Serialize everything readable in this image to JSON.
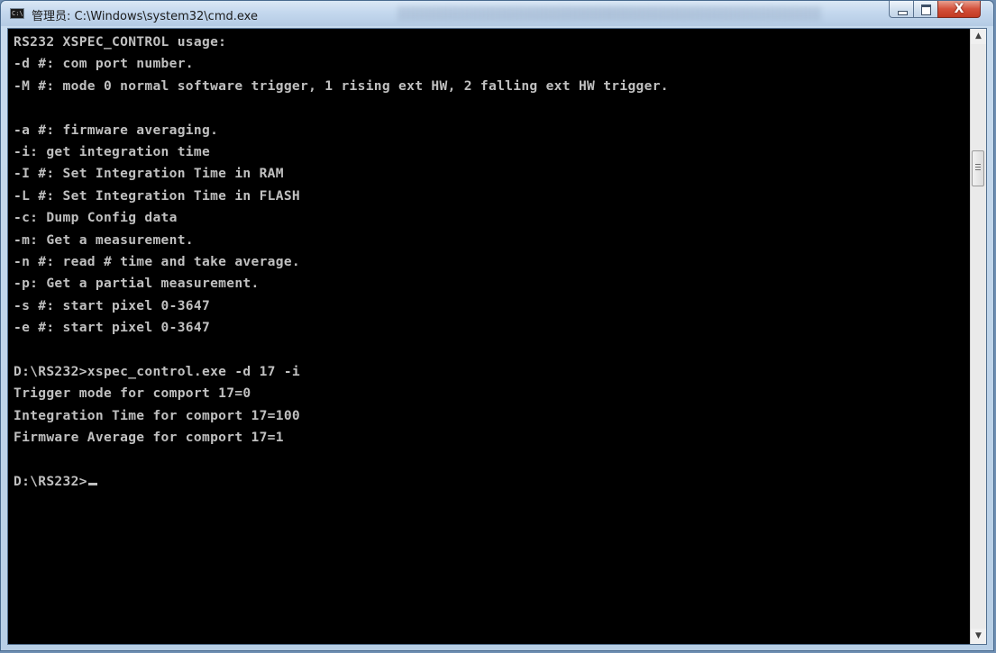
{
  "window": {
    "title": "管理员: C:\\Windows\\system32\\cmd.exe",
    "icon": "console-icon",
    "icon_label": "C:\\",
    "buttons": {
      "minimize": "minimize-icon",
      "maximize": "maximize-icon",
      "close": "X"
    }
  },
  "console": {
    "lines": [
      "RS232 XSPEC_CONTROL usage:",
      "-d #: com port number.",
      "-M #: mode 0 normal software trigger, 1 rising ext HW, 2 falling ext HW trigger.",
      "",
      "-a #: firmware averaging.",
      "-i: get integration time",
      "-I #: Set Integration Time in RAM",
      "-L #: Set Integration Time in FLASH",
      "-c: Dump Config data",
      "-m: Get a measurement.",
      "-n #: read # time and take average.",
      "-p: Get a partial measurement.",
      "-s #: start pixel 0-3647",
      "-e #: start pixel 0-3647",
      "",
      "D:\\RS232>xspec_control.exe -d 17 -i",
      "Trigger mode for comport 17=0",
      "Integration Time for comport 17=100",
      "Firmware Average for comport 17=1",
      ""
    ],
    "prompt": "D:\\RS232>",
    "foreground": "#c0c0c0",
    "background": "#000000"
  },
  "scrollbar": {
    "up_arrow": "▲",
    "down_arrow": "▼"
  }
}
